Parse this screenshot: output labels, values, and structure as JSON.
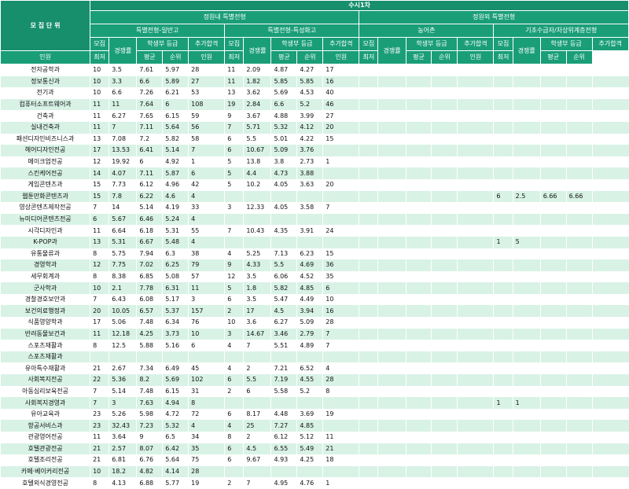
{
  "header": {
    "unit_label": "모 집 단 위",
    "top_title": "수시1차",
    "group_in": "정원내 특별전형",
    "group_out": "정원외 특별전형",
    "sections": [
      "특별전형-일반고",
      "특별전형-특성화고",
      "농어촌",
      "기초수급자/차상위계층전형"
    ],
    "col_recruit_top": "모집",
    "col_recruit_bottom": "인원",
    "col_recruit_full": "모 집 인원",
    "col_comp": "경쟁률",
    "col_grade": "학생부 등급",
    "col_extra_top": "추가합격",
    "col_extra_bottom": "순위",
    "col_min": "최저",
    "col_avg": "평균"
  },
  "rows": [
    {
      "name": "전자공학과",
      "v": [
        "10",
        "3.5",
        "7.61",
        "5.97",
        "28",
        "11",
        "2.09",
        "4.87",
        "4.27",
        "17",
        "",
        "",
        "",
        "",
        "",
        "",
        "",
        "",
        "",
        "",
        ""
      ]
    },
    {
      "name": "정보통신과",
      "v": [
        "10",
        "3.3",
        "6.6",
        "5.89",
        "27",
        "11",
        "1.82",
        "5.85",
        "5.85",
        "16",
        "",
        "",
        "",
        "",
        "",
        "",
        "",
        "",
        "",
        "",
        ""
      ]
    },
    {
      "name": "전기과",
      "v": [
        "10",
        "6.6",
        "7.26",
        "6.21",
        "53",
        "13",
        "3.62",
        "5.69",
        "4.53",
        "40",
        "",
        "",
        "",
        "",
        "",
        "",
        "",
        "",
        "",
        "",
        ""
      ]
    },
    {
      "name": "컴퓨터소프트웨어과",
      "v": [
        "11",
        "11",
        "7.64",
        "6",
        "108",
        "19",
        "2.84",
        "6.6",
        "5.2",
        "46",
        "",
        "",
        "",
        "",
        "",
        "",
        "",
        "",
        "",
        "",
        ""
      ]
    },
    {
      "name": "건축과",
      "v": [
        "11",
        "6.27",
        "7.65",
        "6.15",
        "59",
        "9",
        "3.67",
        "4.88",
        "3.99",
        "27",
        "",
        "",
        "",
        "",
        "",
        "",
        "",
        "",
        "",
        "",
        ""
      ]
    },
    {
      "name": "실내건축과",
      "v": [
        "11",
        "7",
        "7.11",
        "5.64",
        "56",
        "7",
        "5.71",
        "5.32",
        "4.12",
        "20",
        "",
        "",
        "",
        "",
        "",
        "",
        "",
        "",
        "",
        "",
        ""
      ]
    },
    {
      "name": "패션디자인비즈니스과",
      "v": [
        "13",
        "7.08",
        "7.2",
        "5.82",
        "58",
        "6",
        "5.5",
        "5.01",
        "4.22",
        "15",
        "",
        "",
        "",
        "",
        "",
        "",
        "",
        "",
        "",
        "",
        ""
      ]
    },
    {
      "name": "헤어디자인전공",
      "v": [
        "17",
        "13.53",
        "6.41",
        "5.14",
        "7",
        "6",
        "10.67",
        "5.09",
        "3.76",
        "",
        "",
        "",
        "",
        "",
        "",
        "",
        "",
        "",
        "",
        "",
        ""
      ]
    },
    {
      "name": "메이크업전공",
      "v": [
        "12",
        "19.92",
        "6",
        "4.92",
        "1",
        "5",
        "13.8",
        "3.8",
        "2.73",
        "1",
        "",
        "",
        "",
        "",
        "",
        "",
        "",
        "",
        "",
        "",
        ""
      ]
    },
    {
      "name": "스킨케어전공",
      "v": [
        "14",
        "4.07",
        "7.11",
        "5.87",
        "6",
        "5",
        "4.4",
        "4.73",
        "3.88",
        "",
        "",
        "",
        "",
        "",
        "",
        "",
        "",
        "",
        "",
        "",
        ""
      ]
    },
    {
      "name": "게임콘텐츠과",
      "v": [
        "15",
        "7.73",
        "6.12",
        "4.96",
        "42",
        "5",
        "10.2",
        "4.05",
        "3.63",
        "20",
        "",
        "",
        "",
        "",
        "",
        "",
        "",
        "",
        "",
        "",
        ""
      ]
    },
    {
      "name": "웹툰만화콘텐츠과",
      "v": [
        "15",
        "7.8",
        "6.22",
        "4.6",
        "4",
        "",
        "",
        "",
        "",
        "",
        "",
        "",
        "",
        "",
        "",
        "6",
        "2.5",
        "6.66",
        "6.66",
        "",
        ""
      ]
    },
    {
      "name": "영상콘텐츠제작전공",
      "v": [
        "7",
        "14",
        "5.14",
        "4.19",
        "33",
        "3",
        "12.33",
        "4.05",
        "3.58",
        "7",
        "",
        "",
        "",
        "",
        "",
        "",
        "",
        "",
        "",
        "",
        ""
      ]
    },
    {
      "name": "뉴미디어콘텐츠전공",
      "v": [
        "6",
        "5.67",
        "6.46",
        "5.24",
        "4",
        "",
        "",
        "",
        "",
        "",
        "",
        "",
        "",
        "",
        "",
        "",
        "",
        "",
        "",
        "",
        ""
      ]
    },
    {
      "name": "시각디자인과",
      "v": [
        "11",
        "6.64",
        "6.18",
        "5.31",
        "55",
        "7",
        "10.43",
        "4.35",
        "3.91",
        "24",
        "",
        "",
        "",
        "",
        "",
        "",
        "",
        "",
        "",
        "",
        ""
      ]
    },
    {
      "name": "K-POP과",
      "v": [
        "13",
        "5.31",
        "6.67",
        "5.48",
        "4",
        "",
        "",
        "",
        "",
        "",
        "",
        "",
        "",
        "",
        "",
        "1",
        "5",
        "",
        "",
        "",
        ""
      ]
    },
    {
      "name": "유통물류과",
      "v": [
        "8",
        "5.75",
        "7.94",
        "6.3",
        "38",
        "4",
        "5.25",
        "7.13",
        "6.23",
        "15",
        "",
        "",
        "",
        "",
        "",
        "",
        "",
        "",
        "",
        "",
        ""
      ]
    },
    {
      "name": "경영학과",
      "v": [
        "12",
        "7.75",
        "7.02",
        "6.25",
        "79",
        "9",
        "4.33",
        "5.5",
        "4.69",
        "36",
        "",
        "",
        "",
        "",
        "",
        "",
        "",
        "",
        "",
        "",
        ""
      ]
    },
    {
      "name": "세무회계과",
      "v": [
        "8",
        "8.38",
        "6.85",
        "5.08",
        "57",
        "12",
        "3.5",
        "6.06",
        "4.52",
        "35",
        "",
        "",
        "",
        "",
        "",
        "",
        "",
        "",
        "",
        "",
        ""
      ]
    },
    {
      "name": "군사학과",
      "v": [
        "10",
        "2.1",
        "7.78",
        "6.31",
        "11",
        "5",
        "1.8",
        "5.82",
        "4.85",
        "6",
        "",
        "",
        "",
        "",
        "",
        "",
        "",
        "",
        "",
        "",
        ""
      ]
    },
    {
      "name": "경찰경호보안과",
      "v": [
        "7",
        "6.43",
        "6.08",
        "5.17",
        "3",
        "6",
        "3.5",
        "5.47",
        "4.49",
        "10",
        "",
        "",
        "",
        "",
        "",
        "",
        "",
        "",
        "",
        "",
        ""
      ]
    },
    {
      "name": "보건의료행정과",
      "v": [
        "20",
        "10.05",
        "6.57",
        "5.37",
        "157",
        "2",
        "17",
        "4.5",
        "3.94",
        "16",
        "",
        "",
        "",
        "",
        "",
        "",
        "",
        "",
        "",
        "",
        ""
      ]
    },
    {
      "name": "식품영양학과",
      "v": [
        "17",
        "5.06",
        "7.48",
        "6.34",
        "76",
        "10",
        "3.6",
        "6.27",
        "5.09",
        "28",
        "",
        "",
        "",
        "",
        "",
        "",
        "",
        "",
        "",
        "",
        ""
      ]
    },
    {
      "name": "반려동물보건과",
      "v": [
        "11",
        "12.18",
        "4.25",
        "3.73",
        "10",
        "3",
        "14.67",
        "3.46",
        "2.79",
        "7",
        "",
        "",
        "",
        "",
        "",
        "",
        "",
        "",
        "",
        "",
        ""
      ]
    },
    {
      "name": "스포츠재활과",
      "v": [
        "8",
        "12.5",
        "5.88",
        "5.16",
        "6",
        "4",
        "7",
        "5.51",
        "4.89",
        "7",
        "",
        "",
        "",
        "",
        "",
        "",
        "",
        "",
        "",
        "",
        ""
      ]
    },
    {
      "name": "스포츠재활과",
      "v": [
        "",
        "",
        "",
        "",
        "",
        "",
        "",
        "",
        "",
        "",
        "",
        "",
        "",
        "",
        "",
        "",
        "",
        "",
        "",
        "",
        ""
      ]
    },
    {
      "name": "유아특수재활과",
      "v": [
        "21",
        "2.67",
        "7.34",
        "6.49",
        "45",
        "4",
        "2",
        "7.21",
        "6.52",
        "4",
        "",
        "",
        "",
        "",
        "",
        "",
        "",
        "",
        "",
        "",
        ""
      ]
    },
    {
      "name": "사회복지전공",
      "v": [
        "22",
        "5.36",
        "8.2",
        "5.69",
        "102",
        "6",
        "5.5",
        "7.19",
        "4.55",
        "28",
        "",
        "",
        "",
        "",
        "",
        "",
        "",
        "",
        "",
        "",
        ""
      ]
    },
    {
      "name": "아동심리보육전공",
      "v": [
        "7",
        "5.14",
        "7.48",
        "6.15",
        "31",
        "2",
        "6",
        "5.58",
        "5.2",
        "8",
        "",
        "",
        "",
        "",
        "",
        "",
        "",
        "",
        "",
        "",
        ""
      ]
    },
    {
      "name": "사회복지경영과",
      "v": [
        "7",
        "3",
        "7.63",
        "4.94",
        "8",
        "",
        "",
        "",
        "",
        "",
        "",
        "",
        "",
        "",
        "",
        "1",
        "1",
        "",
        "",
        "",
        ""
      ]
    },
    {
      "name": "유아교육과",
      "v": [
        "23",
        "5.26",
        "5.98",
        "4.72",
        "72",
        "6",
        "8.17",
        "4.48",
        "3.69",
        "19",
        "",
        "",
        "",
        "",
        "",
        "",
        "",
        "",
        "",
        "",
        ""
      ]
    },
    {
      "name": "항공서비스과",
      "v": [
        "23",
        "32.43",
        "7.23",
        "5.32",
        "4",
        "4",
        "25",
        "7.27",
        "4.85",
        "",
        "",
        "",
        "",
        "",
        "",
        "",
        "",
        "",
        "",
        "",
        ""
      ]
    },
    {
      "name": "관광영어전공",
      "v": [
        "11",
        "3.64",
        "9",
        "6.5",
        "34",
        "8",
        "2",
        "6.12",
        "5.12",
        "11",
        "",
        "",
        "",
        "",
        "",
        "",
        "",
        "",
        "",
        "",
        ""
      ]
    },
    {
      "name": "호텔관광전공",
      "v": [
        "21",
        "2.57",
        "8.07",
        "6.42",
        "35",
        "6",
        "4.5",
        "6.55",
        "5.49",
        "21",
        "",
        "",
        "",
        "",
        "",
        "",
        "",
        "",
        "",
        "",
        ""
      ]
    },
    {
      "name": "호텔조리전공",
      "v": [
        "21",
        "6.81",
        "6.76",
        "5.64",
        "75",
        "6",
        "9.67",
        "4.93",
        "4.25",
        "18",
        "",
        "",
        "",
        "",
        "",
        "",
        "",
        "",
        "",
        "",
        ""
      ]
    },
    {
      "name": "카페·베이커리전공",
      "v": [
        "10",
        "18.2",
        "4.82",
        "4.14",
        "28",
        "",
        "",
        "",
        "",
        "",
        "",
        "",
        "",
        "",
        "",
        "",
        "",
        "",
        "",
        "",
        ""
      ]
    },
    {
      "name": "호텔외식경영전공",
      "v": [
        "8",
        "4.13",
        "6.88",
        "5.77",
        "19",
        "2",
        "7",
        "4.95",
        "4.76",
        "1",
        "",
        "",
        "",
        "",
        "",
        "",
        "",
        "",
        "",
        "",
        ""
      ]
    }
  ]
}
